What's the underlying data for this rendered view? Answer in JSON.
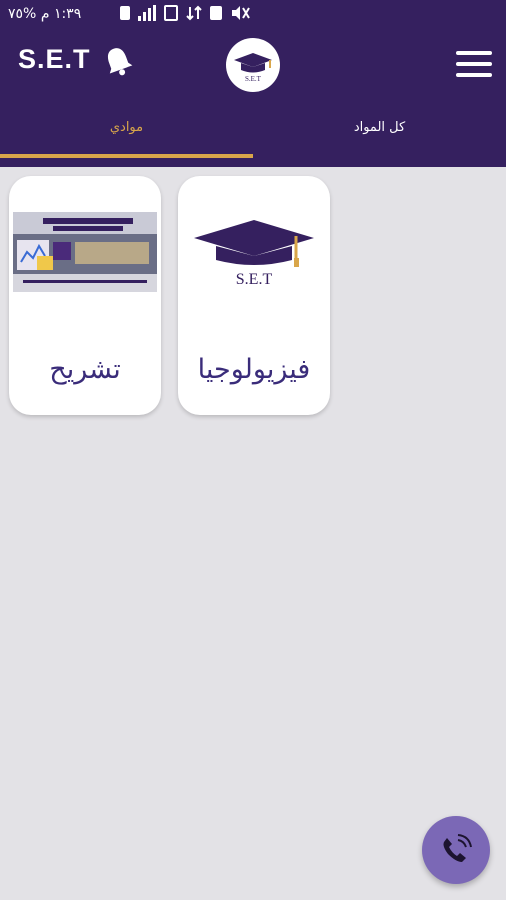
{
  "status_bar": {
    "time": "١:٣٩ م",
    "battery": "%٧٥"
  },
  "header": {
    "brand": "S.E.T",
    "logo_text": "S.E.T"
  },
  "tabs": [
    {
      "label": "موادي",
      "active": true
    },
    {
      "label": "كل المواد",
      "active": false
    }
  ],
  "courses": [
    {
      "name": "فيزيولوجيا",
      "image": "S.E.T graduation cap logo"
    },
    {
      "name": "تشريح",
      "image": "course banner thumbnail"
    }
  ],
  "colors": {
    "primary": "#35205f",
    "accent": "#d9a64a",
    "background": "#e3e2e6",
    "fab": "#7b68b6"
  }
}
